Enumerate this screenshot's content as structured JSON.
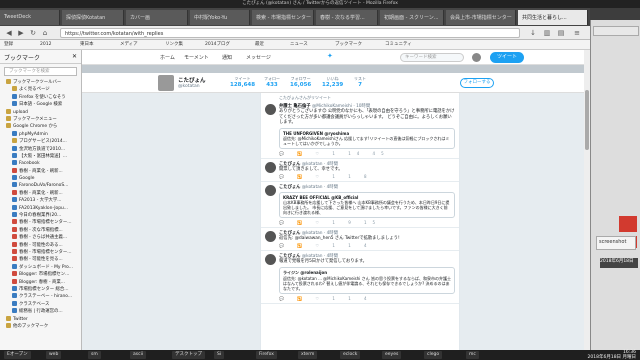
{
  "window": {
    "title": "こたぴょん (@kotatan) さん / Twitterからの返信ツイート - Mozilla Firefox"
  },
  "tabs": [
    {
      "label": "TweetDeck"
    },
    {
      "label": "探偵探偵Kotatan"
    },
    {
      "label": "カバー画"
    },
    {
      "label": "中村駅Yoko-Yu"
    },
    {
      "label": "検索 - 市場指標センター"
    },
    {
      "label": "春樹 - 次なる学習..."
    },
    {
      "label": "初期画面 - スクリーン..."
    },
    {
      "label": "会員上市-市場指標センター"
    },
    {
      "label": "共同生活と暮らし..."
    }
  ],
  "navbar": {
    "url": "https://twitter.com/kotatan/with_replies"
  },
  "bookmark_bar": [
    "登録",
    "2012",
    "東日本",
    "メディア",
    "リンク集",
    "2014ブログ",
    "最近",
    "ニュース",
    "ブックマーク",
    "コミュニティ"
  ],
  "sidebar": {
    "title": "ブックマーク",
    "search_placeholder": "ブックマークを検索",
    "items": [
      {
        "label": "ブックマークツールバー",
        "level": 1,
        "icon": "folder"
      },
      {
        "label": "よく見るページ",
        "level": 2,
        "icon": "folder"
      },
      {
        "label": "Firefox を使いこなそう",
        "level": 2,
        "icon": "blue"
      },
      {
        "label": "日本語 - Google 検索",
        "level": 2,
        "icon": "blue"
      },
      {
        "label": "upload",
        "level": 1,
        "icon": "folder"
      },
      {
        "label": "ブックマークメニュー",
        "level": 1,
        "icon": "folder"
      },
      {
        "label": "Google Chrome から",
        "level": 1,
        "icon": "folder"
      },
      {
        "label": "phpMyAdmin",
        "level": 2,
        "icon": "blue"
      },
      {
        "label": "ブログサービス(2014...",
        "level": 2,
        "icon": "folder"
      },
      {
        "label": "金沢地方鉄道で2010...",
        "level": 2,
        "icon": "blue"
      },
      {
        "label": "【大阪・富田林発送】...",
        "level": 2,
        "icon": "blue"
      },
      {
        "label": "Facebook",
        "level": 2,
        "icon": "blue"
      },
      {
        "label": "春樹 - 商業化 - 刷新...",
        "level": 2,
        "icon": "red"
      },
      {
        "label": "Google",
        "level": 2,
        "icon": "blue"
      },
      {
        "label": "FaronoDuVo/FaronoS...",
        "level": 2,
        "icon": "blue"
      },
      {
        "label": "春樹 - 商業化 - 刷新...",
        "level": 2,
        "icon": "red"
      },
      {
        "label": "FA2013 - 大学大学...",
        "level": 2,
        "icon": "blue"
      },
      {
        "label": "FA2013Kyaklon-Jopu...",
        "level": 2,
        "icon": "blue"
      },
      {
        "label": "今日の春樹業界(20...",
        "level": 2,
        "icon": "blue"
      },
      {
        "label": "春樹 - 市場指標センター...",
        "level": 2,
        "icon": "red"
      },
      {
        "label": "春樹 - 次な市場指標...",
        "level": 2,
        "icon": "red"
      },
      {
        "label": "春樹 - さらば共通主義...",
        "level": 2,
        "icon": "red"
      },
      {
        "label": "春樹 - 可能性のある...",
        "level": 2,
        "icon": "red"
      },
      {
        "label": "春樹 - 市場指標センター...",
        "level": 2,
        "icon": "red"
      },
      {
        "label": "春樹 - 可能性を見る...",
        "level": 2,
        "icon": "red"
      },
      {
        "label": "ダッシュボード - My Pro...",
        "level": 2,
        "icon": "blue"
      },
      {
        "label": "Blogger: 市場指標セン...",
        "level": 2,
        "icon": "red"
      },
      {
        "label": "Blogger: 春樹 - 商業...",
        "level": 2,
        "icon": "red"
      },
      {
        "label": "市場指標センター 総合...",
        "level": 2,
        "icon": "blue"
      },
      {
        "label": "クラステーベー - hirano...",
        "level": 2,
        "icon": "blue"
      },
      {
        "label": "クラステベース",
        "level": 2,
        "icon": "blue"
      },
      {
        "label": "総務省 | 行政運営の...",
        "level": 2,
        "icon": "blue"
      },
      {
        "label": "Twitter",
        "level": 1,
        "icon": "folder"
      },
      {
        "label": "他のブックマーク",
        "level": 1,
        "icon": "folder"
      }
    ]
  },
  "twitter": {
    "nav": [
      "ホーム",
      "モーメント",
      "通知",
      "メッセージ"
    ],
    "search_placeholder": "キーワード検索",
    "tweet_button": "ツイート",
    "profile": {
      "name": "こたぴょん",
      "handle": "@kotatan",
      "follow_button": "フォローする"
    },
    "stats": [
      {
        "label": "ツイート",
        "value": "128,648"
      },
      {
        "label": "フォロー",
        "value": "433"
      },
      {
        "label": "フォロワー",
        "value": "16,056"
      },
      {
        "label": "いいね",
        "value": "12,239"
      },
      {
        "label": "リスト",
        "value": "7"
      }
    ],
    "tweets": [
      {
        "retweet": "こたぴょんさんがリツイート",
        "name": "弁護士 亀石倫子",
        "handle": "@MichikoKameishi",
        "time": "10時間",
        "body": "ありがとうございます😊 公明党のなかにも、「表現の自由を守ろう」と事務所に電話をかけてくださった方が多い都議会議員がいらっしゃいます。 どうぞご自由に。よろしくお願いします。",
        "quote": {
          "name": "THE UNFORGIVEN @ryoshima",
          "text": "返信先: @MichikoKameishiさん 応援してます!リツイートの直後は気軽にブロックされはミュートしてはいかがでしょうか。"
        },
        "actions": "1  14  45"
      },
      {
        "name": "こたぴょん",
        "handle": "@kotatan",
        "time": "4時間",
        "body": "開票して頂きまして、幸せです。",
        "actions": "1  1  8"
      },
      {
        "name": "こたぴょん",
        "handle": "@kotatan",
        "time": "4時間",
        "body": "",
        "quote": {
          "name": "KRAZY BEE OFFICIAL @KB_official",
          "text": "山本KB事務所を応援して下さった皆様へ 山本KB事務所の議会を行うため、本日昨日9日に提出致しました。 市長に応援、ご意見をして頂けましたら幸いです。ファンの皆様に大きく前向きに行き渡れる様、"
        },
        "actions": "1  9  15"
      },
      {
        "name": "こたぴょん",
        "handle": "@kotatan",
        "time": "4時間",
        "body": "返信先: @daiwawan_hen5 さん Twitterで拡散ましましょう!",
        "actions": "1  1  4"
      },
      {
        "name": "こたぴょん",
        "handle": "@kotatan",
        "time": "4時間",
        "body": "報道で党報を月5日かけて発信しております。",
        "quote": {
          "name": "ライジン @rolenaijon",
          "text": "返信先: @kotatan ... @MichikoKameishi さん 皆の思う投票をするならば、和泉市の弁護士はなんて投票されるわ? 替えし値が伴電論る、それとも保存できるでしょうか? 決めるのはあなたです。"
        },
        "actions": "1  1  4"
      }
    ]
  },
  "desktop": {
    "bg_window_label": "screenshot",
    "datebadge": "2018年6月18日"
  },
  "taskbar": {
    "items": [
      "Eオープン",
      "web",
      "sm",
      "ascii",
      "デスクトップ",
      "Si",
      "Firefox",
      "xterm",
      "eclock",
      "eeyes",
      "clego",
      "mc"
    ],
    "time": "16:36",
    "date": "2018年6月18日 月曜日"
  }
}
